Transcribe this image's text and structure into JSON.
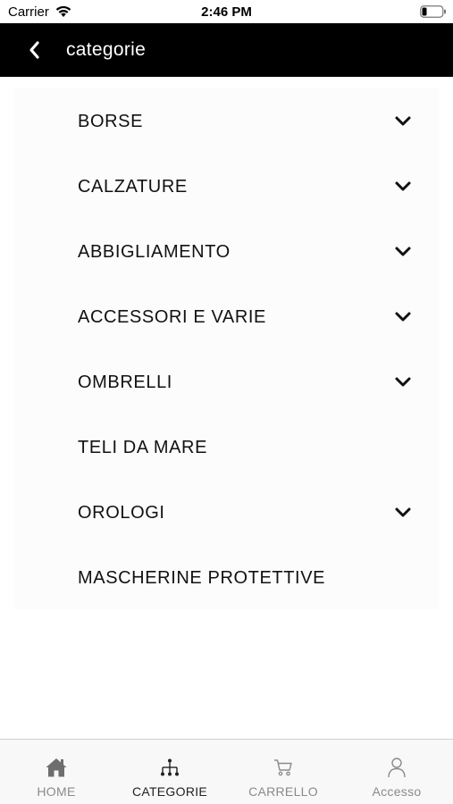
{
  "status_bar": {
    "carrier": "Carrier",
    "time": "2:46 PM"
  },
  "nav": {
    "title": "categorie",
    "back_icon": "chevron-left-icon"
  },
  "categories": [
    {
      "label": "BORSE",
      "expandable": true
    },
    {
      "label": "CALZATURE",
      "expandable": true
    },
    {
      "label": "ABBIGLIAMENTO",
      "expandable": true
    },
    {
      "label": "ACCESSORI E VARIE",
      "expandable": true
    },
    {
      "label": "OMBRELLI",
      "expandable": true
    },
    {
      "label": "TELI DA MARE",
      "expandable": false
    },
    {
      "label": "OROLOGI",
      "expandable": true
    },
    {
      "label": "MASCHERINE PROTETTIVE",
      "expandable": false
    }
  ],
  "tab_bar": {
    "tabs": [
      {
        "label": "HOME",
        "icon": "home-icon",
        "active": false,
        "color": "#8a8a8a"
      },
      {
        "label": "CATEGORIE",
        "icon": "category-tree-icon",
        "active": true,
        "color": "#222222"
      },
      {
        "label": "CARRELLO",
        "icon": "cart-icon",
        "active": false,
        "color": "#8a8a8a"
      },
      {
        "label": "Accesso",
        "icon": "user-icon",
        "active": false,
        "color": "#8a8a8a"
      }
    ]
  },
  "colors": {
    "nav_background": "#000000",
    "active_tab": "#222222",
    "inactive_tab": "#8a8a8a"
  }
}
